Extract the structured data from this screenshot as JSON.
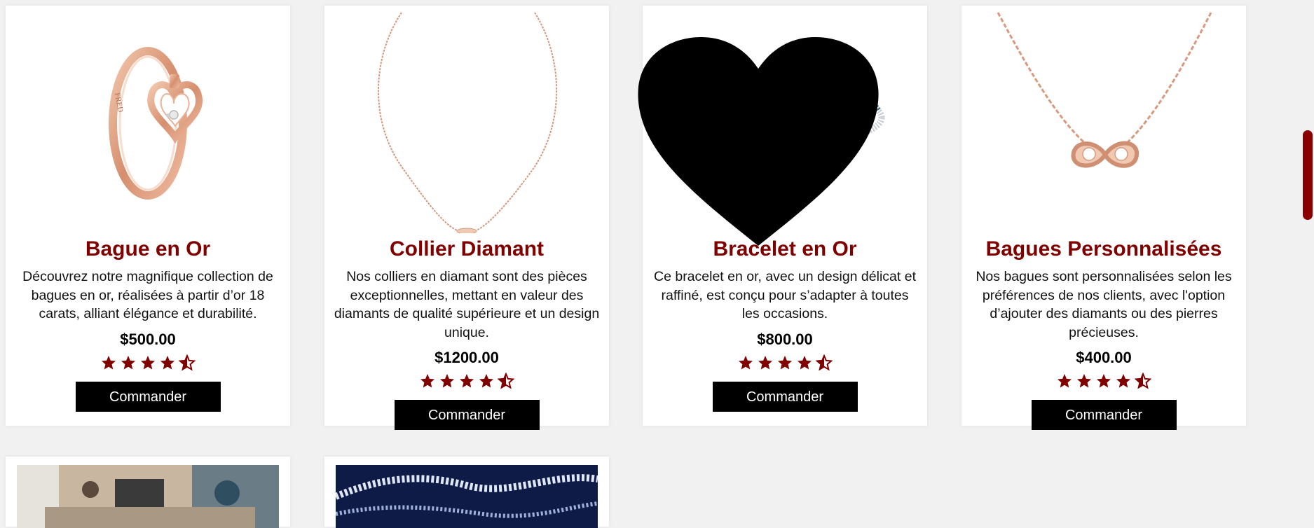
{
  "products": [
    {
      "title": "Bague en Or",
      "description": "Découvrez notre magnifique collection de bagues en or, réalisées à partir d’or 18 carats, alliant élégance et durabilité.",
      "price": "$500.00",
      "rating": 4.5,
      "button_label": "Commander",
      "image": "rose-gold-heart-ring"
    },
    {
      "title": "Collier Diamant",
      "description": "Nos colliers en diamant sont des pièces exceptionnelles, mettant en valeur des diamants de qualité supérieure et un design unique.",
      "price": "$1200.00",
      "rating": 4.5,
      "button_label": "Commander",
      "image": "rose-gold-pendant-necklace"
    },
    {
      "title": "Bracelet en Or",
      "description": "Ce bracelet en or, avec un design délicat et raffiné, est conçu pour s’adapter à toutes les occasions.",
      "price": "$800.00",
      "rating": 4.5,
      "button_label": "Commander",
      "image": "white-gold-diamond-bracelet",
      "favorite": true
    },
    {
      "title": "Bagues Personnalisées",
      "description": "Nos bagues sont personnalisées selon les préférences de nos clients, avec l'option d’ajouter des diamants ou des pierres précieuses.",
      "price": "$400.00",
      "rating": 4.5,
      "button_label": "Commander",
      "image": "rose-gold-knot-necklace"
    }
  ],
  "more_items": [
    {
      "image": "jewelry-workshop-photo"
    },
    {
      "image": "diamond-necklace-on-blue-photo"
    }
  ],
  "colors": {
    "accent": "#800000",
    "button_bg": "#000000",
    "button_text": "#ffffff",
    "page_bg": "#f1f1f1",
    "scrollbar_thumb": "#8b0000"
  },
  "icons": {
    "favorite": "heart-icon",
    "rating_full": "star-icon",
    "rating_half": "half-star-icon"
  }
}
